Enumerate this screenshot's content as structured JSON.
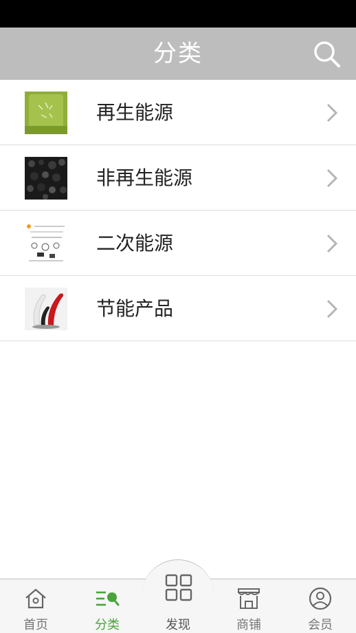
{
  "header": {
    "title": "分类"
  },
  "categories": [
    {
      "label": "再生能源",
      "icon": "chevron-right-icon"
    },
    {
      "label": "非再生能源",
      "icon": "chevron-right-icon"
    },
    {
      "label": "二次能源",
      "icon": "chevron-right-icon"
    },
    {
      "label": "节能产品",
      "icon": "chevron-right-icon"
    }
  ],
  "tabbar": {
    "home": "首页",
    "category": "分类",
    "discover": "发现",
    "shop": "商铺",
    "member": "会员",
    "active": "category"
  },
  "colors": {
    "header_bg": "#bdbdbd",
    "accent": "#4aa33c"
  }
}
